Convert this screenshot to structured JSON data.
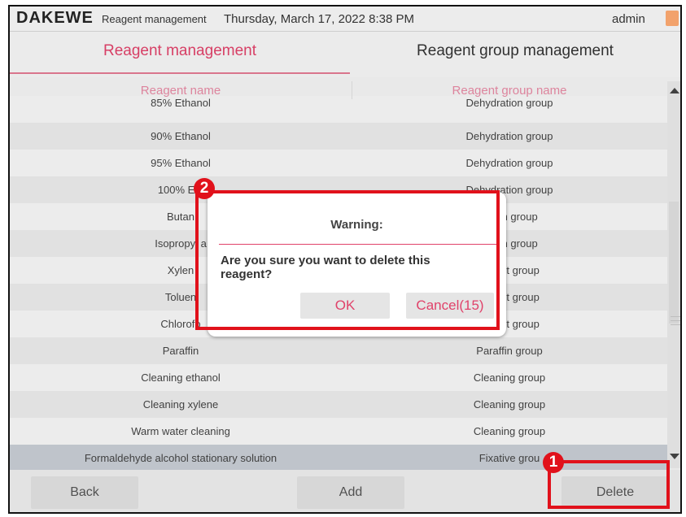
{
  "header": {
    "brand": "DAKEWE",
    "module": "Reagent management",
    "datetime": "Thursday, March 17, 2022 8:38 PM",
    "user": "admin"
  },
  "tabs": [
    {
      "label": "Reagent management",
      "active": true
    },
    {
      "label": "Reagent group management",
      "active": false
    }
  ],
  "table": {
    "columns": [
      "Reagent name",
      "Reagent group name"
    ],
    "rows": [
      {
        "name": "85% Ethanol",
        "group": "Dehydration group"
      },
      {
        "name": "90% Ethanol",
        "group": "Dehydration group"
      },
      {
        "name": "95% Ethanol",
        "group": "Dehydration group"
      },
      {
        "name": "100% Eth",
        "group": "Dehydration group"
      },
      {
        "name": "Butan",
        "group": "ration group"
      },
      {
        "name": "Isopropyl a",
        "group": "ration group"
      },
      {
        "name": "Xylen",
        "group": "parent group"
      },
      {
        "name": "Toluen",
        "group": "parent group"
      },
      {
        "name": "Chlorofo",
        "group": "parent group"
      },
      {
        "name": "Paraffin",
        "group": "Paraffin group"
      },
      {
        "name": "Cleaning ethanol",
        "group": "Cleaning group"
      },
      {
        "name": "Cleaning xylene",
        "group": "Cleaning group"
      },
      {
        "name": "Warm water cleaning",
        "group": "Cleaning group"
      },
      {
        "name": "Formaldehyde alcohol stationary solution",
        "group": "Fixative grou",
        "selected": true
      }
    ]
  },
  "buttons": {
    "back": "Back",
    "add": "Add",
    "delete": "Delete"
  },
  "dialog": {
    "title": "Warning:",
    "message": "Are you sure you want to delete this reagent?",
    "ok": "OK",
    "cancel": "Cancel(15)"
  },
  "callouts": {
    "step1": "1",
    "step2": "2"
  },
  "colors": {
    "accent": "#e0426a",
    "highlight": "#e1111b",
    "selected_row": "#c7cdd4"
  }
}
